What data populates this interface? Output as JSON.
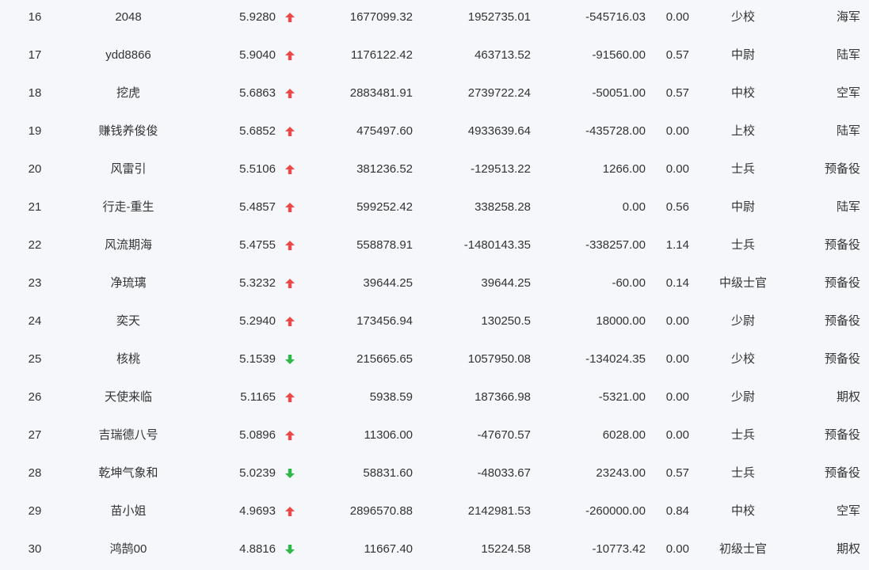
{
  "rows": [
    {
      "rank": "16",
      "name": "2048",
      "score": "5.9280",
      "trend": "up",
      "v1": "1677099.32",
      "v2": "1952735.01",
      "v3": "-545716.03",
      "v4": "0.00",
      "title": "少校",
      "branch": "海军"
    },
    {
      "rank": "17",
      "name": "ydd8866",
      "score": "5.9040",
      "trend": "up",
      "v1": "1176122.42",
      "v2": "463713.52",
      "v3": "-91560.00",
      "v4": "0.57",
      "title": "中尉",
      "branch": "陆军"
    },
    {
      "rank": "18",
      "name": "挖虎",
      "score": "5.6863",
      "trend": "up",
      "v1": "2883481.91",
      "v2": "2739722.24",
      "v3": "-50051.00",
      "v4": "0.57",
      "title": "中校",
      "branch": "空军"
    },
    {
      "rank": "19",
      "name": "赚钱养俊俊",
      "score": "5.6852",
      "trend": "up",
      "v1": "475497.60",
      "v2": "4933639.64",
      "v3": "-435728.00",
      "v4": "0.00",
      "title": "上校",
      "branch": "陆军"
    },
    {
      "rank": "20",
      "name": "风雷引",
      "score": "5.5106",
      "trend": "up",
      "v1": "381236.52",
      "v2": "-129513.22",
      "v3": "1266.00",
      "v4": "0.00",
      "title": "士兵",
      "branch": "预备役"
    },
    {
      "rank": "21",
      "name": "行走-重生",
      "score": "5.4857",
      "trend": "up",
      "v1": "599252.42",
      "v2": "338258.28",
      "v3": "0.00",
      "v4": "0.56",
      "title": "中尉",
      "branch": "陆军"
    },
    {
      "rank": "22",
      "name": "风流期海",
      "score": "5.4755",
      "trend": "up",
      "v1": "558878.91",
      "v2": "-1480143.35",
      "v3": "-338257.00",
      "v4": "1.14",
      "title": "士兵",
      "branch": "预备役"
    },
    {
      "rank": "23",
      "name": "净琉璃",
      "score": "5.3232",
      "trend": "up",
      "v1": "39644.25",
      "v2": "39644.25",
      "v3": "-60.00",
      "v4": "0.14",
      "title": "中级士官",
      "branch": "预备役"
    },
    {
      "rank": "24",
      "name": "奕天",
      "score": "5.2940",
      "trend": "up",
      "v1": "173456.94",
      "v2": "130250.5",
      "v3": "18000.00",
      "v4": "0.00",
      "title": "少尉",
      "branch": "预备役"
    },
    {
      "rank": "25",
      "name": "核桃",
      "score": "5.1539",
      "trend": "down",
      "v1": "215665.65",
      "v2": "1057950.08",
      "v3": "-134024.35",
      "v4": "0.00",
      "title": "少校",
      "branch": "预备役"
    },
    {
      "rank": "26",
      "name": "天使来临",
      "score": "5.1165",
      "trend": "up",
      "v1": "5938.59",
      "v2": "187366.98",
      "v3": "-5321.00",
      "v4": "0.00",
      "title": "少尉",
      "branch": "期权"
    },
    {
      "rank": "27",
      "name": "吉瑞德八号",
      "score": "5.0896",
      "trend": "up",
      "v1": "11306.00",
      "v2": "-47670.57",
      "v3": "6028.00",
      "v4": "0.00",
      "title": "士兵",
      "branch": "预备役"
    },
    {
      "rank": "28",
      "name": "乾坤气象和",
      "score": "5.0239",
      "trend": "down",
      "v1": "58831.60",
      "v2": "-48033.67",
      "v3": "23243.00",
      "v4": "0.57",
      "title": "士兵",
      "branch": "预备役"
    },
    {
      "rank": "29",
      "name": "苗小姐",
      "score": "4.9693",
      "trend": "up",
      "v1": "2896570.88",
      "v2": "2142981.53",
      "v3": "-260000.00",
      "v4": "0.84",
      "title": "中校",
      "branch": "空军"
    },
    {
      "rank": "30",
      "name": "鸿鹄00",
      "score": "4.8816",
      "trend": "down",
      "v1": "11667.40",
      "v2": "15224.58",
      "v3": "-10773.42",
      "v4": "0.00",
      "title": "初级士官",
      "branch": "期权"
    }
  ],
  "colors": {
    "up": "#f04848",
    "down": "#2fb84a",
    "text": "#333333",
    "background": "#f5f7fa"
  },
  "icons": {
    "up": "arrow-up-icon",
    "down": "arrow-down-icon"
  }
}
